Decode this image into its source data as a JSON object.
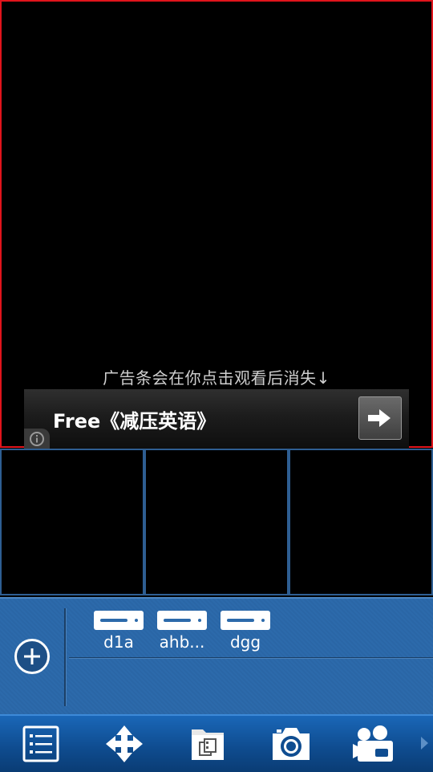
{
  "main_view": {
    "ad_hint": "广告条会在你点击观看后消失↓",
    "ad_title": "Free《减压英语》"
  },
  "devices": [
    {
      "label": "d1a"
    },
    {
      "label": "ahb..."
    },
    {
      "label": "dgg"
    }
  ],
  "toolbar": {
    "items": [
      "list-icon",
      "move-icon",
      "files-icon",
      "camera-icon",
      "video-camera-icon"
    ]
  },
  "colors": {
    "main_view_border": "#e0141c",
    "panel_blue": "#2c6aab",
    "toolbar_blue": "#0f4d91"
  }
}
